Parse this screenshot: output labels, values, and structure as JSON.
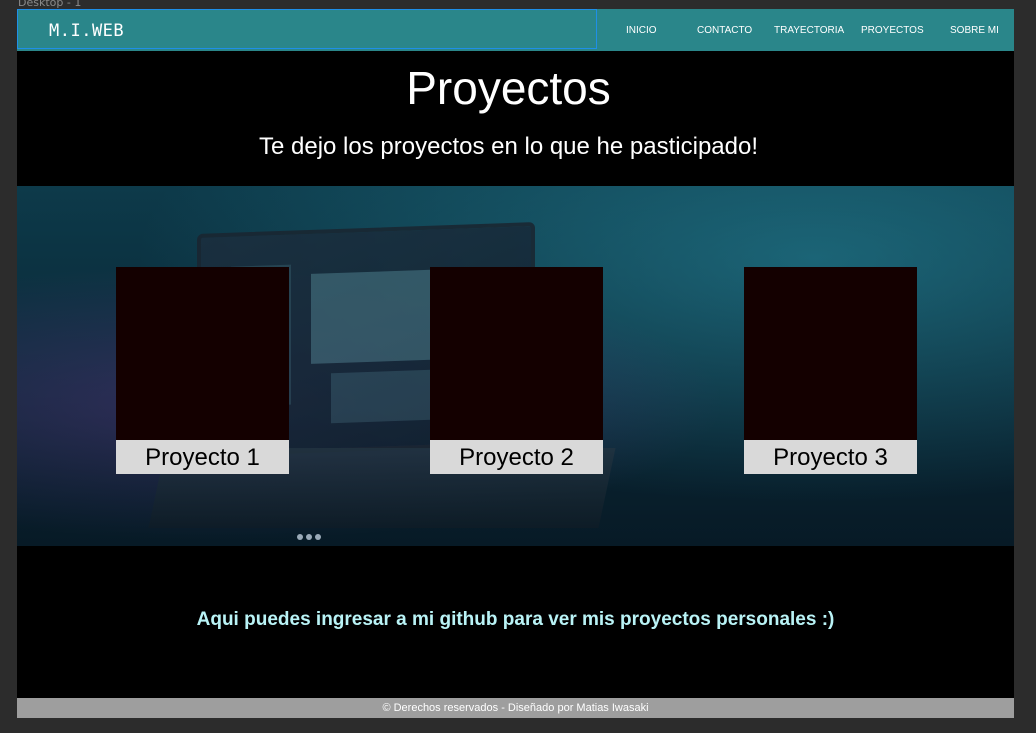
{
  "frame": {
    "label": "Desktop - 1"
  },
  "navbar": {
    "brand": "M.I.WEB",
    "items": [
      {
        "label": "INICIO"
      },
      {
        "label": "CONTACTO"
      },
      {
        "label": "TRAYECTORIA"
      },
      {
        "label": "PROYECTOS"
      },
      {
        "label": "SOBRE MI"
      }
    ]
  },
  "main": {
    "title": "Proyectos",
    "subtitle": "Te dejo los proyectos en lo que he pasticipado!"
  },
  "projects": [
    {
      "label": "Proyecto 1"
    },
    {
      "label": "Proyecto 2"
    },
    {
      "label": "Proyecto 3"
    }
  ],
  "github": {
    "text": "Aqui puedes ingresar a mi github para ver mis proyectos personales :)"
  },
  "footer": {
    "text": "© Derechos reservados - Diseñado por Matias Iwasaki"
  },
  "colors": {
    "navbar": "#2a868a",
    "selection": "#1e8fe8",
    "card": "#140000",
    "card_label": "#d9d9d9",
    "github_text": "#b9f3f6",
    "footer": "#9e9e9e"
  }
}
